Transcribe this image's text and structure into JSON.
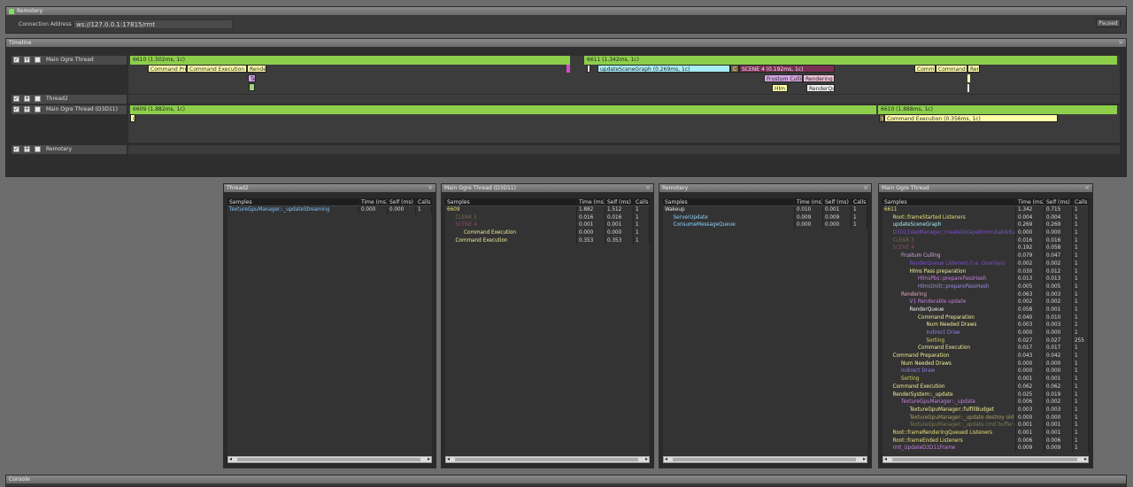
{
  "remotery": {
    "title": "Remotery",
    "connection_label": "Connection Address",
    "connection_address": "ws://127.0.0.1:17815/rmt",
    "pause_label": "Paused"
  },
  "timeline": {
    "title": "Timeline",
    "rows": [
      {
        "name": "Main Ogre Thread"
      },
      {
        "name": "Thread2"
      },
      {
        "name": "Main Ogre Thread (D3D11)"
      },
      {
        "name": "Remotery"
      }
    ],
    "frames": {
      "f6610_main": "6610 (1.502ms, 1c)",
      "f6611_main": "6611 (1.342ms, 1c)",
      "f6609_d3d": "6609 (1.882ms, 1c)",
      "f6610_d3d": "6610 (1.888ms, 1c)"
    },
    "blocks": {
      "cmd_pre": "Command Pre",
      "cmd_exec": "Command Execution (",
      "rende": "Rende",
      "te": "Te",
      "update_scene": "updateSceneGraph (0.269ms, 1c)",
      "c1": "C",
      "scene4": "SCENE 4 (0.192ms, 1c)",
      "frustum": "Frustum Cullin",
      "rendering": "Rendering",
      "hlm": "Hlm",
      "renderqu": "RenderQu",
      "comm": "Comm",
      "command": "Command",
      "rer": "Rer",
      "d3d_c": "C",
      "d3d_c2": "C",
      "d3d_cmd_exec": "Command Execution (0.356ms, 1c)"
    }
  },
  "columns": {
    "samples": "Samples",
    "time": "Time (ms)",
    "self": "Self (ms)",
    "calls": "Calls"
  },
  "panels": {
    "thread2": {
      "title": "Thread2",
      "rows": [
        {
          "name": "TextureGpuManager::_updateStreaming",
          "time": "0.000",
          "self": "0.000",
          "calls": "1",
          "indent": 0,
          "color": "#7fc6ff"
        }
      ]
    },
    "d3d11": {
      "title": "Main Ogre Thread (D3D11)",
      "rows": [
        {
          "name": "6609",
          "time": "1.882",
          "self": "1.512",
          "calls": "1",
          "indent": 0,
          "color": "#e8e07a"
        },
        {
          "name": "CLEAR 3",
          "time": "0.016",
          "self": "0.016",
          "calls": "1",
          "indent": 1,
          "color": "#7a6a55"
        },
        {
          "name": "SCENE 4",
          "time": "0.001",
          "self": "0.001",
          "calls": "1",
          "indent": 1,
          "color": "#8a4a62"
        },
        {
          "name": "Command Execution",
          "time": "0.000",
          "self": "0.000",
          "calls": "1",
          "indent": 2,
          "color": "#f3f09a"
        },
        {
          "name": "Command Execution",
          "time": "0.353",
          "self": "0.353",
          "calls": "1",
          "indent": 1,
          "color": "#f3f09a"
        }
      ]
    },
    "remotery": {
      "title": "Remotery",
      "rows": [
        {
          "name": "Wakeup",
          "time": "0.010",
          "self": "0.001",
          "calls": "1",
          "indent": 0,
          "color": "#e6e6e6"
        },
        {
          "name": "ServerUpdate",
          "time": "0.009",
          "self": "0.009",
          "calls": "1",
          "indent": 1,
          "color": "#8fd0ff"
        },
        {
          "name": "ConsumeMessageQueue",
          "time": "0.000",
          "self": "0.000",
          "calls": "1",
          "indent": 1,
          "color": "#8fd0ff"
        }
      ]
    },
    "main": {
      "title": "Main Ogre Thread",
      "rows": [
        {
          "name": "6611",
          "time": "1.342",
          "self": "0.715",
          "calls": "1",
          "indent": 0,
          "color": "#e8e07a"
        },
        {
          "name": "Root::frameStarted Listeners",
          "time": "0.004",
          "self": "0.004",
          "calls": "1",
          "indent": 1,
          "color": "#e8e07a"
        },
        {
          "name": "updateSceneGraph",
          "time": "0.269",
          "self": "0.269",
          "calls": "1",
          "indent": 1,
          "color": "#a8eef8"
        },
        {
          "name": "D3D11VaoManager::createDelayedImmutableBuffers",
          "time": "0.000",
          "self": "0.000",
          "calls": "1",
          "indent": 1,
          "color": "#7a4fd0"
        },
        {
          "name": "CLEAR 3",
          "time": "0.016",
          "self": "0.016",
          "calls": "1",
          "indent": 1,
          "color": "#7a6a55"
        },
        {
          "name": "SCENE 4",
          "time": "0.192",
          "self": "0.058",
          "calls": "1",
          "indent": 1,
          "color": "#8a4a62"
        },
        {
          "name": "Frustum Culling",
          "time": "0.079",
          "self": "0.047",
          "calls": "1",
          "indent": 2,
          "color": "#d7a6e6"
        },
        {
          "name": "RenderQueue Listeners (i.e. Overlays)",
          "time": "0.002",
          "self": "0.002",
          "calls": "1",
          "indent": 3,
          "color": "#7a4fd0"
        },
        {
          "name": "Hlms Pass preparation",
          "time": "0.030",
          "self": "0.012",
          "calls": "1",
          "indent": 3,
          "color": "#f3f09a"
        },
        {
          "name": "HlmsPbs::preparePassHash",
          "time": "0.013",
          "self": "0.013",
          "calls": "1",
          "indent": 4,
          "color": "#c77fe0"
        },
        {
          "name": "HlmsUnlit::preparePassHash",
          "time": "0.005",
          "self": "0.005",
          "calls": "1",
          "indent": 4,
          "color": "#9a8fe0"
        },
        {
          "name": "Rendering",
          "time": "0.063",
          "self": "0.003",
          "calls": "1",
          "indent": 2,
          "color": "#e8a6c6"
        },
        {
          "name": "V1 Renderable update",
          "time": "0.002",
          "self": "0.002",
          "calls": "1",
          "indent": 3,
          "color": "#c77fe0"
        },
        {
          "name": "RenderQueue",
          "time": "0.058",
          "self": "0.001",
          "calls": "1",
          "indent": 3,
          "color": "#f0f0f0"
        },
        {
          "name": "Command Preparation",
          "time": "0.040",
          "self": "0.010",
          "calls": "1",
          "indent": 4,
          "color": "#f3f09a"
        },
        {
          "name": "Num Needed Draws",
          "time": "0.003",
          "self": "0.003",
          "calls": "1",
          "indent": 5,
          "color": "#f3f09a"
        },
        {
          "name": "Indirect Draw",
          "time": "0.000",
          "self": "0.000",
          "calls": "1",
          "indent": 5,
          "color": "#8a7ff0"
        },
        {
          "name": "Sorting",
          "time": "0.027",
          "self": "0.027",
          "calls": "255",
          "indent": 5,
          "color": "#d8d860"
        },
        {
          "name": "Command Execution",
          "time": "0.017",
          "self": "0.017",
          "calls": "1",
          "indent": 4,
          "color": "#f3f09a"
        },
        {
          "name": "Command Preparation",
          "time": "0.043",
          "self": "0.042",
          "calls": "1",
          "indent": 1,
          "color": "#f3f09a"
        },
        {
          "name": "Num Needed Draws",
          "time": "0.000",
          "self": "0.000",
          "calls": "1",
          "indent": 2,
          "color": "#f3f09a"
        },
        {
          "name": "Indirect Draw",
          "time": "0.000",
          "self": "0.000",
          "calls": "1",
          "indent": 2,
          "color": "#8a7ff0"
        },
        {
          "name": "Sorting",
          "time": "0.001",
          "self": "0.001",
          "calls": "1",
          "indent": 2,
          "color": "#d8d860"
        },
        {
          "name": "Command Execution",
          "time": "0.062",
          "self": "0.062",
          "calls": "1",
          "indent": 1,
          "color": "#f3f09a"
        },
        {
          "name": "RenderSystem::_update",
          "time": "0.025",
          "self": "0.019",
          "calls": "1",
          "indent": 1,
          "color": "#f3f09a"
        },
        {
          "name": "TextureGpuManager::_update",
          "time": "0.006",
          "self": "0.002",
          "calls": "1",
          "indent": 2,
          "color": "#c77fe0"
        },
        {
          "name": "TextureGpuManager::fulfillBudget",
          "time": "0.003",
          "self": "0.003",
          "calls": "1",
          "indent": 3,
          "color": "#f3f09a"
        },
        {
          "name": "TextureGpuManager::_update destroy old StagingTextures",
          "time": "0.000",
          "self": "0.000",
          "calls": "1",
          "indent": 3,
          "color": "#b0a060"
        },
        {
          "name": "TextureGpuManager::_update cmd buffer execution",
          "time": "0.001",
          "self": "0.001",
          "calls": "1",
          "indent": 3,
          "color": "#7a7a50"
        },
        {
          "name": "Root::frameRenderingQueued Listeners",
          "time": "0.001",
          "self": "0.001",
          "calls": "1",
          "indent": 1,
          "color": "#e8e07a"
        },
        {
          "name": "Root::frameEnded Listeners",
          "time": "0.006",
          "self": "0.006",
          "calls": "1",
          "indent": 1,
          "color": "#e8e07a"
        },
        {
          "name": "rmt_UpdateD3D11Frame",
          "time": "0.009",
          "self": "0.009",
          "calls": "1",
          "indent": 1,
          "color": "#c77fe0"
        }
      ]
    }
  },
  "console": {
    "title": "Console"
  },
  "colors": {
    "frame_bar": "#8dcf4b",
    "status_ok": "#7fe05a"
  }
}
